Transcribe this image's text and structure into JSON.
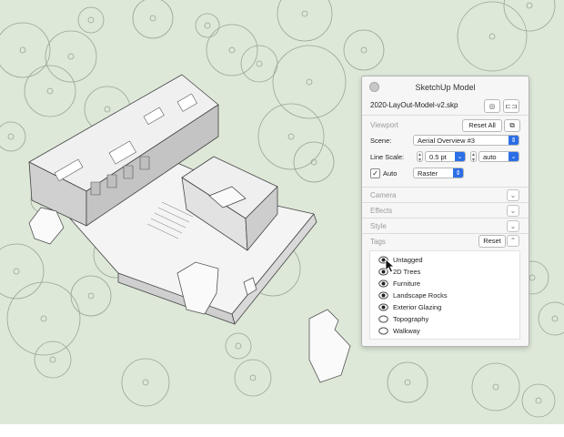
{
  "window": {
    "title": "SketchUp Model",
    "file_name": "2020-LayOut-Model-v2.skp"
  },
  "viewport": {
    "label": "Viewport",
    "reset_all_label": "Reset All",
    "scene_label": "Scene:",
    "scene_value": "Aerial Overview #3",
    "line_scale_label": "Line Scale:",
    "line_scale_value": "0.5 pt",
    "line_scale_auto_value": "auto",
    "auto_label": "Auto",
    "auto_checked": true,
    "render_value": "Raster"
  },
  "sections": {
    "camera": "Camera",
    "effects": "Effects",
    "style": "Style",
    "tags": "Tags",
    "tags_reset_label": "Reset"
  },
  "tags": [
    {
      "label": "Untagged",
      "visible": true
    },
    {
      "label": "2D Trees",
      "visible": true
    },
    {
      "label": "Furniture",
      "visible": true
    },
    {
      "label": "Landscape Rocks",
      "visible": true
    },
    {
      "label": "Exterior Glazing",
      "visible": true
    },
    {
      "label": "Topography",
      "visible": false
    },
    {
      "label": "Walkway",
      "visible": false
    }
  ],
  "colors": {
    "canvas_background": "#dde8d8",
    "accent": "#2b6ee6"
  },
  "icons": {
    "close": "close-dot-icon",
    "scene_camera": "target-icon",
    "link": "link-icon",
    "chevron": "chevron-down-icon",
    "visible": "eye-icon",
    "hidden": "eye-hidden-icon"
  }
}
